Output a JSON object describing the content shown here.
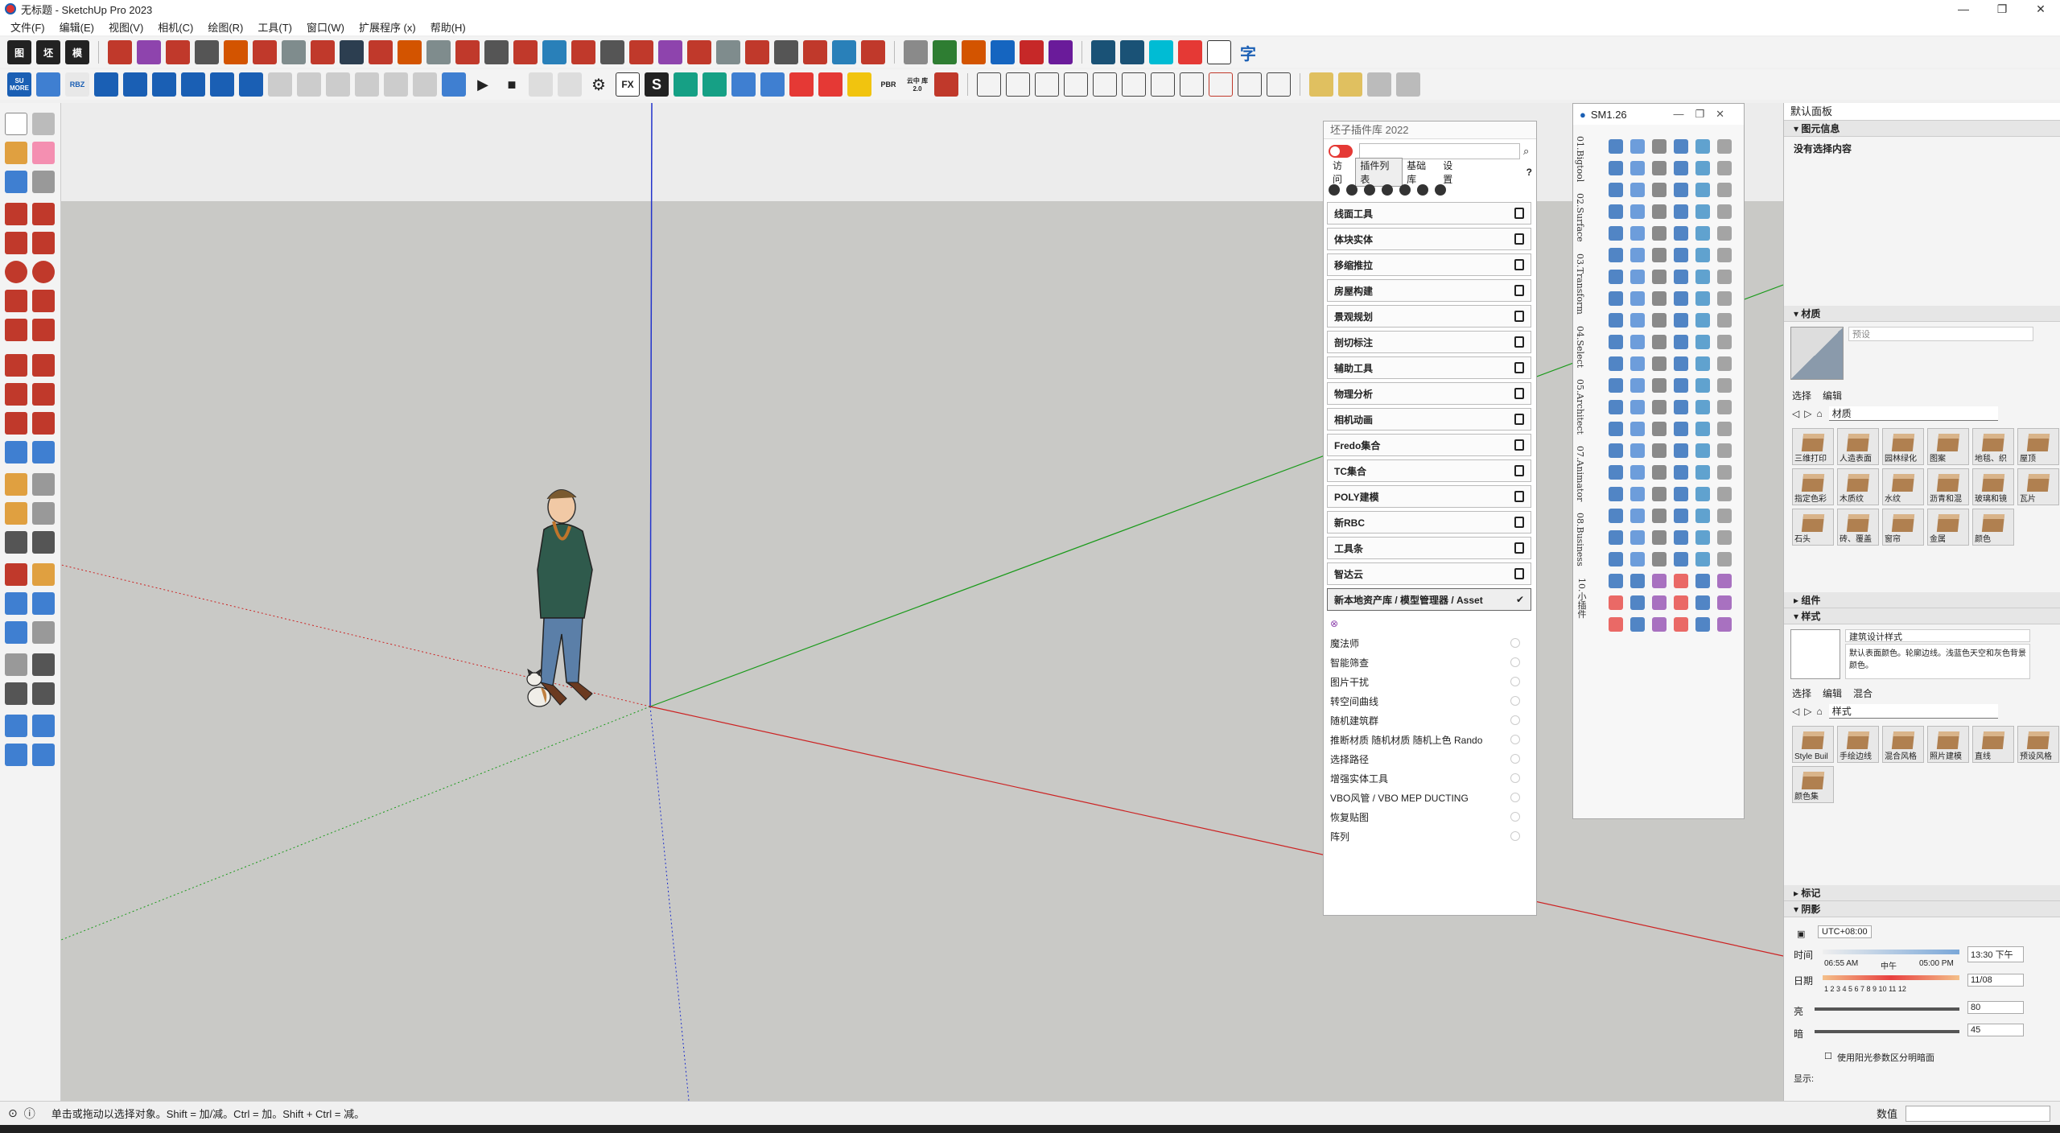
{
  "window": {
    "title": "无标题 - SketchUp Pro 2023",
    "controls": [
      "—",
      "❐",
      "✕"
    ]
  },
  "menu": [
    "文件(F)",
    "编辑(E)",
    "视图(V)",
    "相机(C)",
    "绘图(R)",
    "工具(T)",
    "窗口(W)",
    "扩展程序 (x)",
    "帮助(H)"
  ],
  "toolbar": {
    "row1_labels": [
      "图",
      "坯",
      "模"
    ],
    "row1_last": "字",
    "row2_labels": [
      "SU MORE",
      "RBZ",
      "FX",
      "S",
      "PBR",
      "云中 库2.0"
    ]
  },
  "plugin_library": {
    "title": "坯子插件库 2022",
    "search_value": "",
    "tabs": [
      "访问",
      "插件列表",
      "基础库",
      "设置"
    ],
    "active_tab": "插件列表",
    "help": "?",
    "categories": [
      "线面工具",
      "体块实体",
      "移缩推拉",
      "房屋构建",
      "景观规划",
      "剖切标注",
      "辅助工具",
      "物理分析",
      "相机动画",
      "Fredo集合",
      "TC集合",
      "POLY建模",
      "新RBC",
      "工具条",
      "智达云",
      "新本地资产库 / 模型管理器 / Asset"
    ],
    "items": [
      "魔法师",
      "智能筛查",
      "图片干扰",
      "转空间曲线",
      "随机建筑群",
      "推断材质 随机材质 随机上色 Rando",
      "选择路径",
      "增强实体工具",
      "VBO风管 / VBO MEP DUCTING",
      "恢复贴图",
      "阵列"
    ]
  },
  "sm_panel": {
    "title": "SM1.26",
    "tabs": [
      "01.Bigtool",
      "02.Surface",
      "03.Transform",
      "04.Select",
      "05.Architect",
      "07.Animator",
      "08.Business",
      "10.小插件"
    ]
  },
  "tray": {
    "title": "默认面板",
    "entity_info": {
      "header": "图元信息",
      "text": "没有选择内容"
    },
    "materials": {
      "header": "材质",
      "preset": "预设",
      "tabs": [
        "选择",
        "编辑"
      ],
      "dropdown": "材质",
      "swatches": [
        "三维打印",
        "人造表面",
        "园林绿化",
        "图案",
        "地毯、织",
        "屋顶",
        "指定色彩",
        "木质纹",
        "水纹",
        "沥青和混",
        "玻璃和镜",
        "瓦片",
        "石头",
        "砖、覆盖",
        "窗帘",
        "金属",
        "颜色"
      ]
    },
    "components": {
      "header": "组件"
    },
    "styles": {
      "header": "样式",
      "name": "建筑设计样式",
      "desc": "默认表面颜色。轮廓边线。浅蓝色天空和灰色背景颜色。",
      "tabs": [
        "选择",
        "编辑",
        "混合"
      ],
      "dropdown": "样式",
      "swatches": [
        "Style Buil",
        "手绘边线",
        "混合风格",
        "照片建模",
        "直线",
        "预设风格",
        "颜色集"
      ]
    },
    "tags": {
      "header": "标记"
    },
    "shadows": {
      "header": "阴影",
      "utc": "UTC+08:00",
      "time_label": "时间",
      "time_start": "06:55 AM",
      "time_mid": "中午",
      "time_end": "05:00 PM",
      "time_value": "13:30 下午",
      "date_label": "日期",
      "months": "1 2 3 4 5 6 7 8 9 10 11 12",
      "date_value": "11/08",
      "light_label": "亮",
      "light_value": "80",
      "dark_label": "暗",
      "dark_value": "45",
      "sun_checkbox": "使用阳光参数区分明暗面",
      "display_label": "显示:"
    }
  },
  "status": {
    "message": "单击或拖动以选择对象。Shift = 加/减。Ctrl = 加。Shift + Ctrl = 减。",
    "measure_label": "数值"
  }
}
